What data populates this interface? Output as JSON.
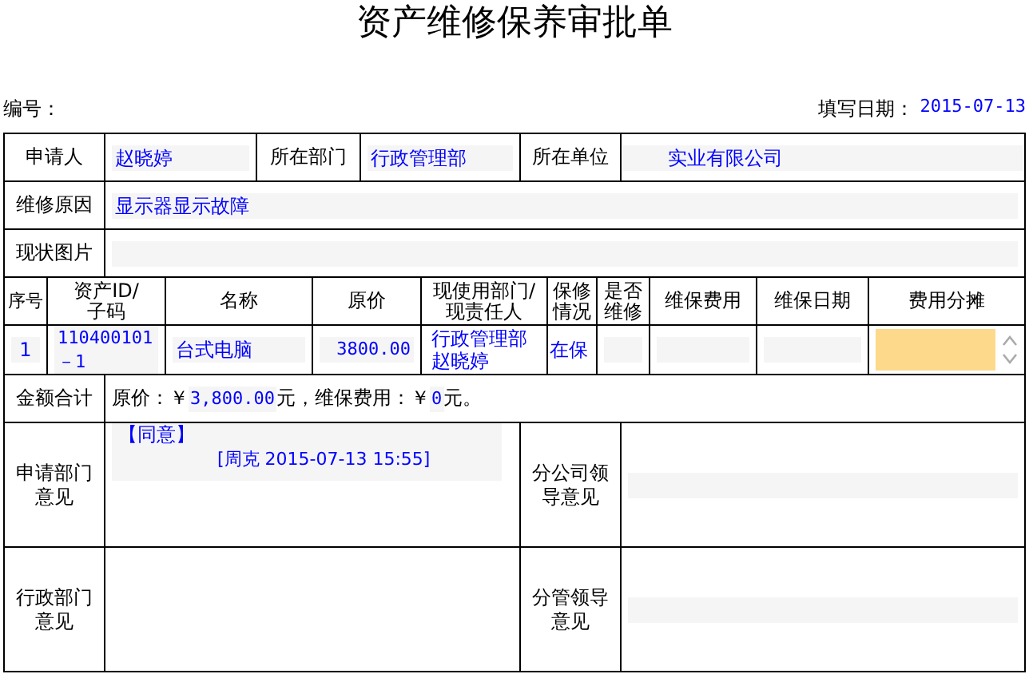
{
  "title": "资产维修保养审批单",
  "header": {
    "number_label": "编号：",
    "date_label": "填写日期：",
    "date": "2015-07-13"
  },
  "applicant": {
    "applicant_label": "申请人",
    "applicant": "赵晓婷",
    "dept_label": "所在部门",
    "dept": "行政管理部",
    "unit_label": "所在单位",
    "unit": "实业有限公司"
  },
  "reason": {
    "label": "维修原因",
    "value": "显示器显示故障"
  },
  "photo": {
    "label": "现状图片"
  },
  "items_table": {
    "columns": [
      "序号",
      "资产ID/子码",
      "名称",
      "原价",
      "现使用部门/现责任人",
      "保修情况",
      "是否维修",
      "维保费用",
      "维保日期",
      "费用分摊"
    ],
    "rows": [
      {
        "index": "1",
        "asset_id": "110400101－1",
        "name": "台式电脑",
        "price": "3800.00",
        "dept": "行政管理部",
        "person": "赵晓婷",
        "warranty": "在保"
      }
    ]
  },
  "total": {
    "label": "金额合计",
    "price_label": "原价：￥",
    "price": "3,800.00",
    "fee_label": "元，维保费用：￥",
    "fee": "0",
    "end": "元。"
  },
  "opinions": [
    {
      "label": "申请部门意见",
      "verdict": "【同意】",
      "signature": "[周克 2015-07-13 15:55]",
      "right_label": "分公司领导意见"
    },
    {
      "label": "行政部门意见",
      "right_label": "分管领导意见"
    }
  ]
}
